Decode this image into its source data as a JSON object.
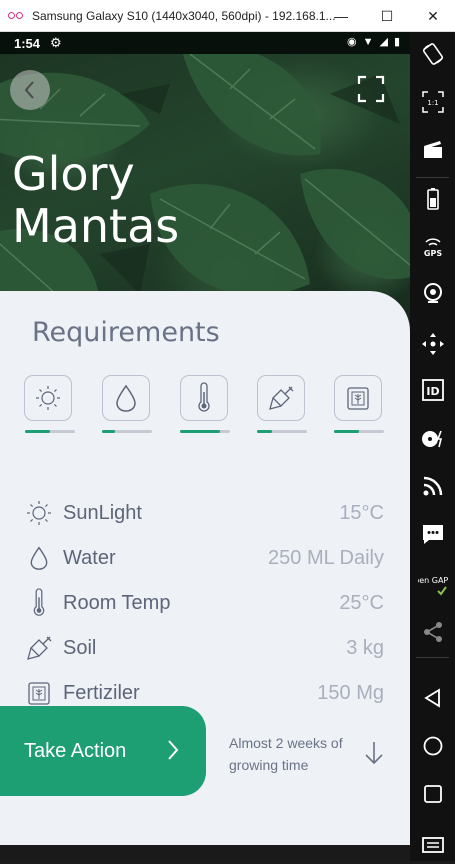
{
  "window": {
    "title": "Samsung Galaxy S10 (1440x3040, 560dpi) - 192.168.1...",
    "minimize_label": "—",
    "maximize_label": "☐",
    "close_label": "✕"
  },
  "statusbar": {
    "time": "1:54"
  },
  "plant": {
    "name": "Glory Mantas"
  },
  "requirements": {
    "title": "Requirements",
    "levels": [
      {
        "name": "sun",
        "level": 0.5
      },
      {
        "name": "water",
        "level": 0.25
      },
      {
        "name": "temperature",
        "level": 0.8
      },
      {
        "name": "soil",
        "level": 0.3
      },
      {
        "name": "fertilizer",
        "level": 0.5
      }
    ],
    "rows": [
      {
        "label": "SunLight",
        "value": "15°C",
        "icon": "sun-icon"
      },
      {
        "label": "Water",
        "value": "250 ML Daily",
        "icon": "water-drop-icon"
      },
      {
        "label": "Room Temp",
        "value": "25°C",
        "icon": "thermometer-icon"
      },
      {
        "label": "Soil",
        "value": "3 kg",
        "icon": "shovel-icon"
      },
      {
        "label": "Fertiziler",
        "value": "150 Mg",
        "icon": "fertilizer-bag-icon"
      }
    ]
  },
  "action": {
    "button_label": "Take Action",
    "note": "Almost 2 weeks of growing time"
  },
  "colors": {
    "accent": "#1e9e73",
    "card_background": "#eef1f6",
    "text_dark": "#5d6579",
    "text_light": "#a9afbc"
  },
  "emulator_toolbar": {
    "items": [
      "rotate-icon",
      "pixel-perfect-icon",
      "screencast-icon",
      "battery-icon",
      "gps-icon",
      "camera-icon",
      "remote-control-icon",
      "identifiers-icon",
      "disk-icon",
      "rss-icon",
      "sms-icon",
      "open-gapps-icon",
      "share-icon",
      "back-icon",
      "home-icon",
      "recent-apps-icon",
      "menu-icon"
    ],
    "labels": {
      "pixel": "1:1",
      "gps": "GPS",
      "id": "ID",
      "opengapps": "Open GAPPS"
    }
  }
}
